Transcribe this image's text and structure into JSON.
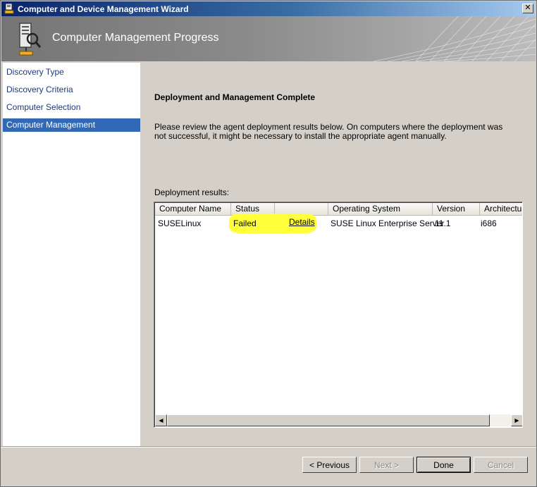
{
  "window": {
    "title": "Computer and Device Management Wizard",
    "close_glyph": "✕"
  },
  "banner": {
    "title": "Computer Management Progress",
    "icon": "computer-management-icon"
  },
  "nav": {
    "items": [
      {
        "label": "Discovery Type",
        "active": false
      },
      {
        "label": "Discovery Criteria",
        "active": false
      },
      {
        "label": "Computer Selection",
        "active": false
      },
      {
        "label": "Computer Management",
        "active": true
      }
    ]
  },
  "content": {
    "title": "Deployment and Management Complete",
    "description": "Please review the agent deployment results below. On computers where the deployment was not successful, it might be necessary to install the appropriate agent manually.",
    "results_label": "Deployment results:"
  },
  "results": {
    "columns": [
      "Computer Name",
      "Status",
      "",
      "Operating System",
      "Version",
      "Architecture"
    ],
    "rows": [
      {
        "computer_name": "SUSELinux",
        "status": "Failed",
        "details": "Details",
        "operating_system": "SUSE Linux Enterprise Server",
        "version": "11.1",
        "architecture": "i686"
      }
    ],
    "highlight_color": "#ffff3a"
  },
  "scrollbar": {
    "left_glyph": "◀",
    "right_glyph": "▶"
  },
  "buttons": {
    "previous": "< Previous",
    "next": "Next >",
    "done": "Done",
    "cancel": "Cancel"
  },
  "colors": {
    "nav_active": "#3169b7",
    "nav_text": "#1c3a7a",
    "titlebar": "#0a246a"
  }
}
